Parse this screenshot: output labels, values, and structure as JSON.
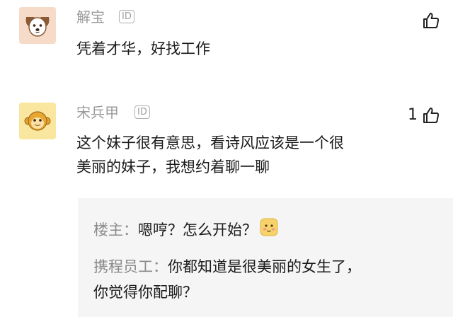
{
  "comments": [
    {
      "username": "解宝",
      "id_badge": "ID",
      "like_count": "",
      "text_lines": [
        "凭着才华，好找工作"
      ]
    },
    {
      "username": "宋兵甲",
      "id_badge": "ID",
      "like_count": "1",
      "text_lines": [
        "这个妹子很有意思，看诗风应该是一个很",
        "美丽的妹子，我想约着聊一聊"
      ]
    }
  ],
  "replies": [
    {
      "author": "楼主：",
      "text": "嗯哼？怎么开始？",
      "emoji": "blushing-face-emoji"
    },
    {
      "author": "携程员工：",
      "text_lines": [
        "你都知道是很美丽的女生了，",
        "你觉得你配聊？"
      ]
    }
  ],
  "icons": {
    "like": "thumbs-up-icon",
    "avatar_1": "dog-avatar",
    "avatar_2": "monkey-avatar"
  },
  "colors": {
    "username": "#9b9b9b",
    "text": "#1a1a1a",
    "reply_bg": "#f5f5f5"
  }
}
